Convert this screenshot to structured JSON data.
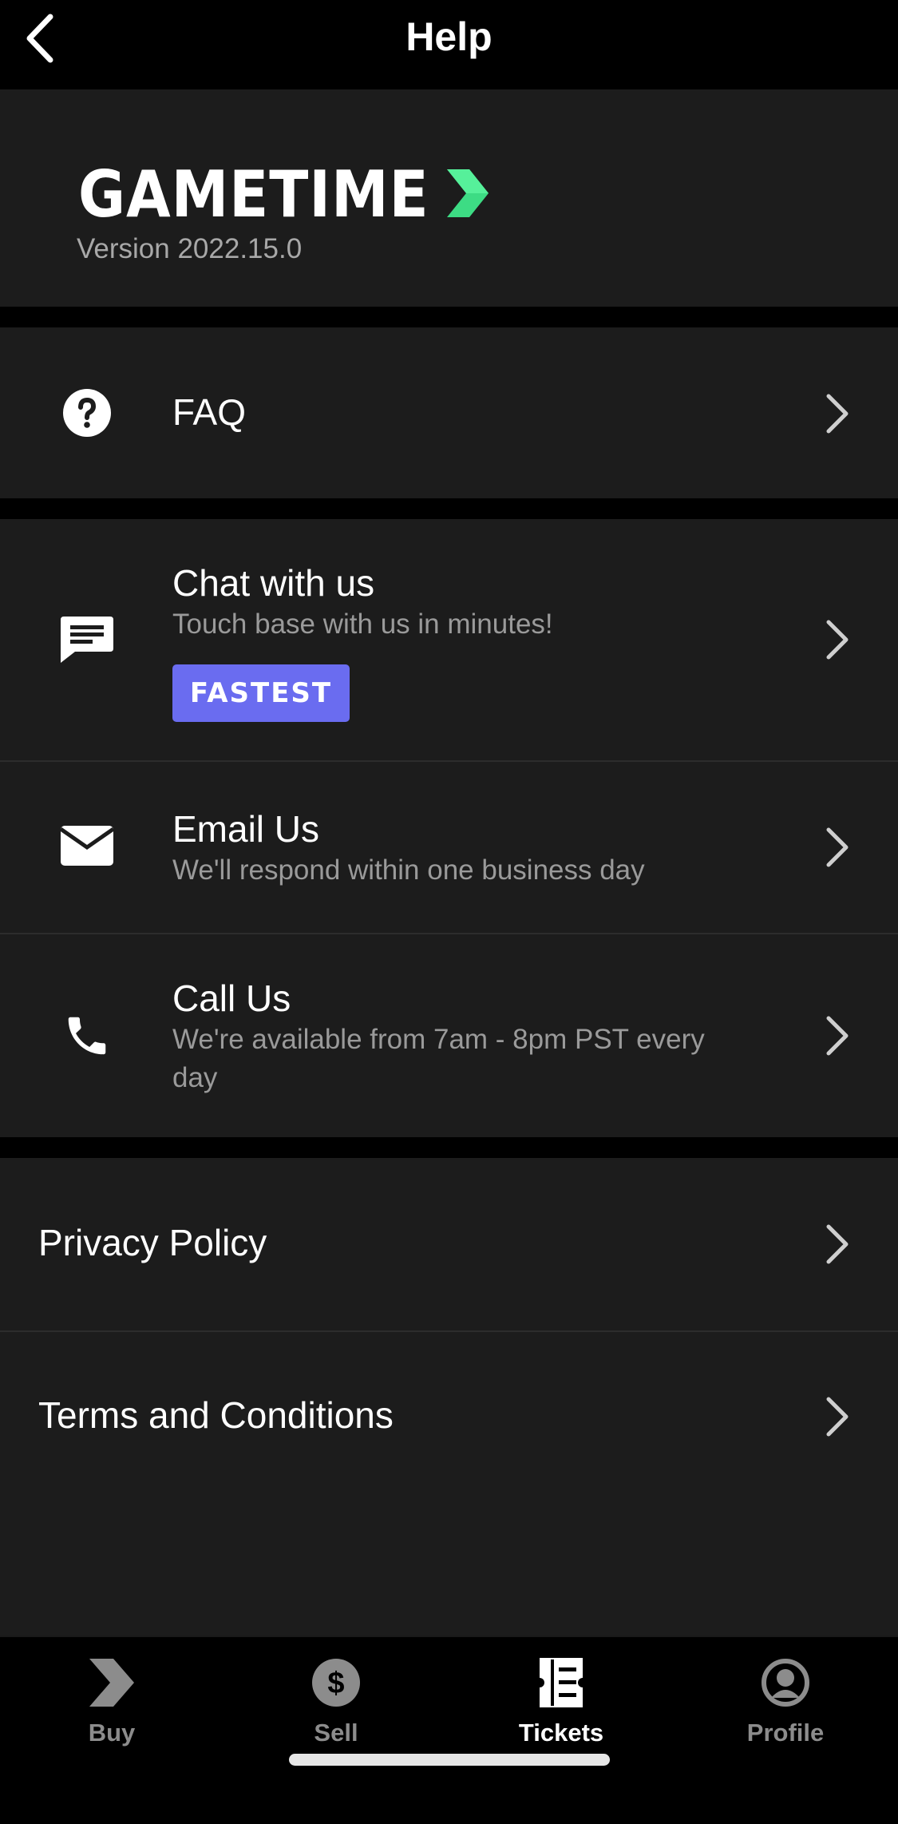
{
  "header": {
    "title": "Help",
    "back_icon": "chevron-left-icon"
  },
  "brand": {
    "logo_text": "GAMETIME",
    "version": "Version 2022.15.0",
    "accent_color": "#3ddc84"
  },
  "faq": {
    "label": "FAQ",
    "icon": "question-circle-icon"
  },
  "contact": {
    "chat": {
      "title": "Chat with us",
      "subtitle": "Touch base with us in minutes!",
      "badge": "FASTEST",
      "badge_color": "#6a6cf0",
      "icon": "chat-bubble-icon"
    },
    "email": {
      "title": "Email Us",
      "subtitle": "We'll respond within one business day",
      "icon": "envelope-icon"
    },
    "call": {
      "title": "Call Us",
      "subtitle": "We're available from 7am - 8pm PST every day",
      "icon": "phone-icon"
    }
  },
  "legal": {
    "privacy": "Privacy Policy",
    "terms": "Terms and Conditions"
  },
  "tabs": [
    {
      "label": "Buy",
      "icon": "gametime-chevron-icon",
      "active": false
    },
    {
      "label": "Sell",
      "icon": "dollar-circle-icon",
      "active": false
    },
    {
      "label": "Tickets",
      "icon": "ticket-icon",
      "active": true
    },
    {
      "label": "Profile",
      "icon": "profile-circle-icon",
      "active": false
    }
  ],
  "colors": {
    "background": "#000000",
    "panel": "#1c1c1c",
    "subtext": "#9a9a9a"
  }
}
